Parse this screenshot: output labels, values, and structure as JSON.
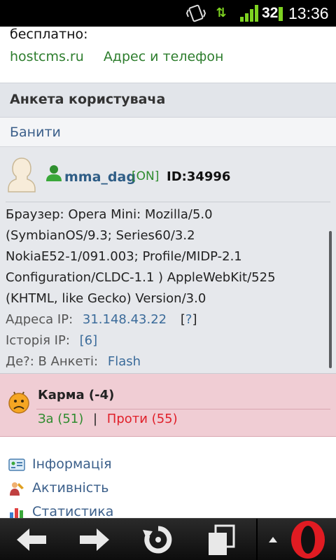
{
  "status_bar": {
    "battery": "32",
    "time": "13:36"
  },
  "top": {
    "free_text": "бесплатно:",
    "link_hostcms": "hostcms.ru",
    "link_address": "Адрес и телефон"
  },
  "profile": {
    "header": "Анкета  користувача",
    "ban_link": "Банити",
    "username": "mma_dag",
    "online": "[ON]",
    "id": "ID:34996",
    "browser_lines": [
      "Браузер:  Opera  Mini:  Mozilla/5.0",
      "(SymbianOS/9.3;   Series60/3.2",
      "NokiaE52-1/091.003;    Profile/MIDP-2.1",
      "Configuration/CLDC-1.1    ) AppleWebKit/525",
      "(KHTML,  like  Gecko)  Version/3.0"
    ],
    "ip_label": "Адреса  IP:",
    "ip_value": "31.148.43.22",
    "ip_query": "?",
    "history_label": "Історія  IP:",
    "history_value": "[6]",
    "where_label": "Де?:  В  Анкеті:",
    "where_value": "Flash"
  },
  "karma": {
    "title": "Карма  (-4)",
    "za": "За  (51)",
    "separator": "|",
    "proty": "Проти  (55)"
  },
  "menu": [
    {
      "label": "Інформація",
      "icon": "info-card-icon"
    },
    {
      "label": "Активність",
      "icon": "paint-person-icon"
    },
    {
      "label": "Статистика",
      "icon": "bar-chart-icon"
    }
  ],
  "colors": {
    "accent_green": "#2e8b2e",
    "link_blue": "#3b5f8a",
    "karma_bg": "#f0cdd4",
    "against_red": "#e0202a"
  }
}
